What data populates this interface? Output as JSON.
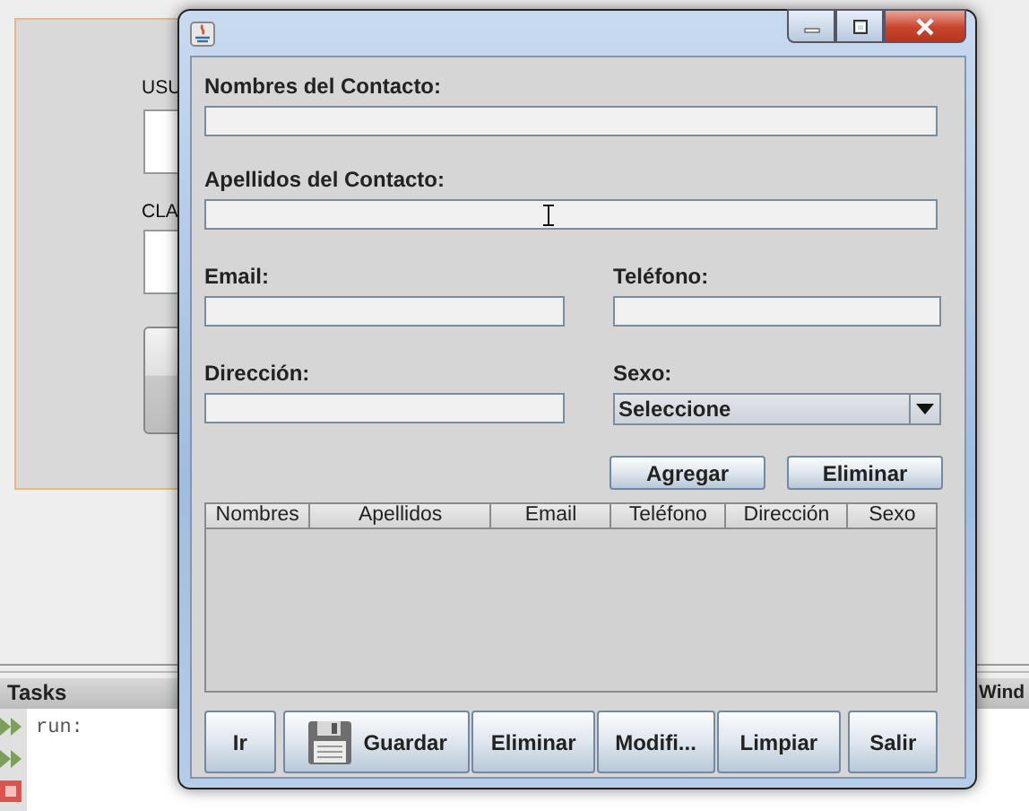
{
  "ide": {
    "login_labels": [
      "USU",
      "CLA"
    ],
    "tasks_tab": "Tasks",
    "console_text": "run:",
    "right_tab": "Wind"
  },
  "dialog": {
    "full_fields": [
      {
        "label": "Nombres del Contacto:"
      },
      {
        "label": "Apellidos del Contacto:",
        "cursor": true
      }
    ],
    "grid_fields": [
      {
        "kind": "text",
        "label": "Email:"
      },
      {
        "kind": "text",
        "label": "Teléfono:"
      },
      {
        "kind": "text",
        "label": "Dirección:"
      },
      {
        "kind": "combo",
        "label": "Sexo:",
        "value": "Seleccione"
      }
    ],
    "row_buttons": [
      "Agregar",
      "Eliminar"
    ],
    "table": {
      "columns": [
        "Nombres",
        "Apellidos",
        "Email",
        "Teléfono",
        "Dirección",
        "Sexo"
      ]
    },
    "bottom_buttons": [
      {
        "label": "Ir",
        "has_icon": false
      },
      {
        "label": "Guardar",
        "has_icon": true
      },
      {
        "label": "Eliminar",
        "has_icon": false
      },
      {
        "label": "Modifi...",
        "has_icon": false
      },
      {
        "label": "Limpiar",
        "has_icon": false
      },
      {
        "label": "Salir",
        "has_icon": false
      }
    ]
  }
}
